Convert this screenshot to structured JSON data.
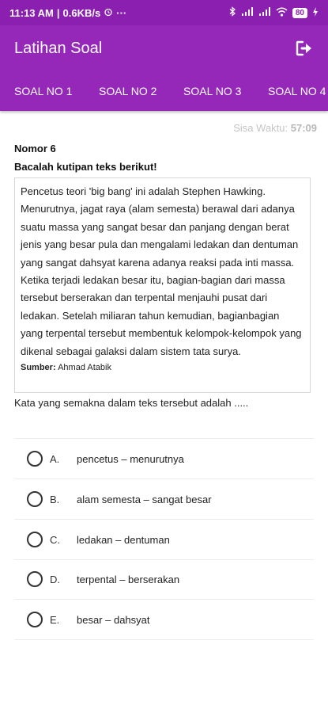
{
  "status_bar": {
    "time": "11:13 AM",
    "speed": "0.6KB/s",
    "more": "···",
    "battery": "80"
  },
  "app_bar": {
    "title": "Latihan Soal",
    "logout_icon": "logout-icon"
  },
  "tabs": [
    {
      "label": "SOAL NO 1"
    },
    {
      "label": "SOAL NO 2"
    },
    {
      "label": "SOAL NO 3"
    },
    {
      "label": "SOAL NO 4"
    }
  ],
  "timer": {
    "label": "Sisa Waktu:",
    "value": "57:09"
  },
  "question": {
    "number": "Nomor 6",
    "instruction": "Bacalah kutipan teks berikut!",
    "passage": "Pencetus teori 'big bang' ini adalah Stephen Hawking. Menurutnya, jagat raya (alam semesta) berawal dari adanya suatu massa yang sangat besar dan panjang dengan berat jenis yang besar pula dan mengalami ledakan dan dentuman yang sangat dahsyat karena adanya reaksi pada inti massa. Ketika terjadi ledakan besar itu, bagian-bagian dari massa tersebut berserakan dan terpental menjauhi pusat dari ledakan. Setelah miliaran tahun kemudian, bagianbagian yang terpental tersebut membentuk kelompok-kelompok yang dikenal sebagai galaksi dalam sistem tata surya.",
    "source_label": "Sumber:",
    "source_value": "Ahmad Atabik",
    "prompt": "Kata yang semakna dalam teks tersebut adalah ....."
  },
  "options": [
    {
      "letter": "A.",
      "text": "pencetus – menurutnya"
    },
    {
      "letter": "B.",
      "text": "alam semesta – sangat besar"
    },
    {
      "letter": "C.",
      "text": "ledakan – dentuman"
    },
    {
      "letter": "D.",
      "text": "terpental – berserakan"
    },
    {
      "letter": "E.",
      "text": "besar – dahsyat"
    }
  ],
  "colors": {
    "primary": "#9528b8",
    "status_bar": "#8a1fb0"
  }
}
